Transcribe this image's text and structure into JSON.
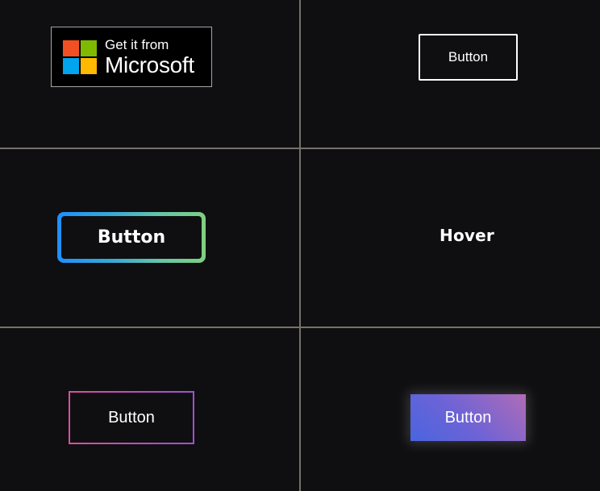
{
  "microsoft_badge": {
    "small_text": "Get it from",
    "big_text": "Microsoft",
    "colors": {
      "red": "#f25022",
      "green": "#7fba00",
      "blue": "#00a4ef",
      "yellow": "#ffb900"
    }
  },
  "buttons": {
    "outline_label": "Button",
    "gradient_border_label": "Button",
    "hover_label": "Hover",
    "pink_border_label": "Button",
    "glow_label": "Button"
  },
  "colors": {
    "background": "#0f0f11",
    "divider": "#77706a"
  }
}
